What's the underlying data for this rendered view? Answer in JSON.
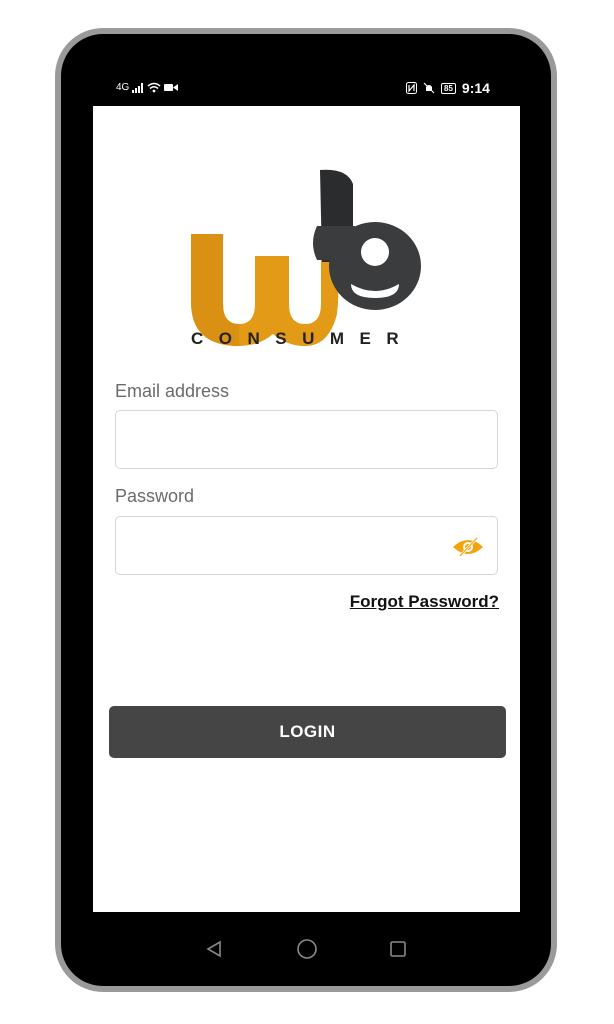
{
  "status_bar": {
    "left_indicators": "4G",
    "time": "9:14",
    "battery": "85"
  },
  "logo": {
    "wordmark": "CONSUMER",
    "brand_colors": {
      "orange": "#e39a17",
      "dark": "#3a3c3e"
    }
  },
  "form": {
    "email_label": "Email address",
    "email_value": "",
    "password_label": "Password",
    "password_value": "",
    "forgot_label": "Forgot Password?",
    "login_label": "LOGIN",
    "eye_icon_color": "#f5a30a"
  },
  "nav": {
    "back_icon": "back-triangle-icon",
    "home_icon": "home-circle-icon",
    "recents_icon": "recents-square-icon"
  }
}
